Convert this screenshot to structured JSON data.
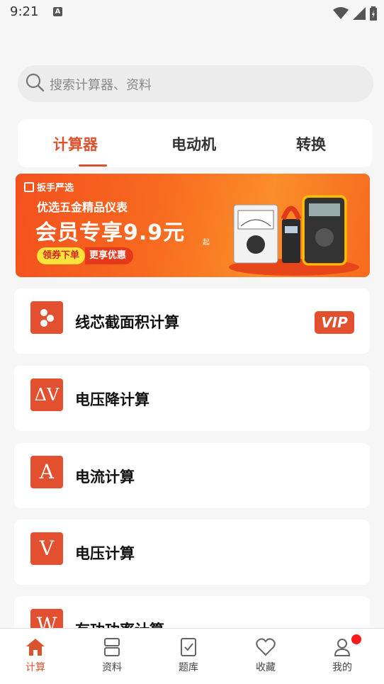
{
  "status_bar": {
    "time": "9:21",
    "notification_letter": "A"
  },
  "search": {
    "placeholder": "搜索计算器、资料"
  },
  "tabs": [
    {
      "label": "计算器",
      "active": true
    },
    {
      "label": "电动机",
      "active": false
    },
    {
      "label": "转换",
      "active": false
    }
  ],
  "banner": {
    "brand": "扳手严选",
    "line1": "优选五金精品仪表",
    "line2": "会员专享9.9元",
    "suffix": "起",
    "pill_left": "领券下单",
    "pill_right": "更享优惠"
  },
  "calculators": [
    {
      "icon_text": "",
      "icon_name": "wire-cross-section-icon",
      "label": "线芯截面积计算",
      "vip": "VIP"
    },
    {
      "icon_text": "ΔV",
      "icon_name": "voltage-drop-icon",
      "label": "电压降计算"
    },
    {
      "icon_text": "A",
      "icon_name": "current-icon",
      "label": "电流计算"
    },
    {
      "icon_text": "V",
      "icon_name": "voltage-icon",
      "label": "电压计算"
    },
    {
      "icon_text": "W",
      "icon_name": "power-icon",
      "label": "有功功率计算"
    }
  ],
  "bottom_nav": [
    {
      "label": "计算",
      "icon": "home-icon",
      "active": true
    },
    {
      "label": "资料",
      "icon": "document-icon"
    },
    {
      "label": "题库",
      "icon": "question-bank-icon"
    },
    {
      "label": "收藏",
      "icon": "heart-icon"
    },
    {
      "label": "我的",
      "icon": "profile-icon",
      "has_badge": true
    }
  ],
  "colors": {
    "accent": "#d9532f",
    "icon_bg": "#e3502f",
    "badge": "#ff1a1a"
  }
}
